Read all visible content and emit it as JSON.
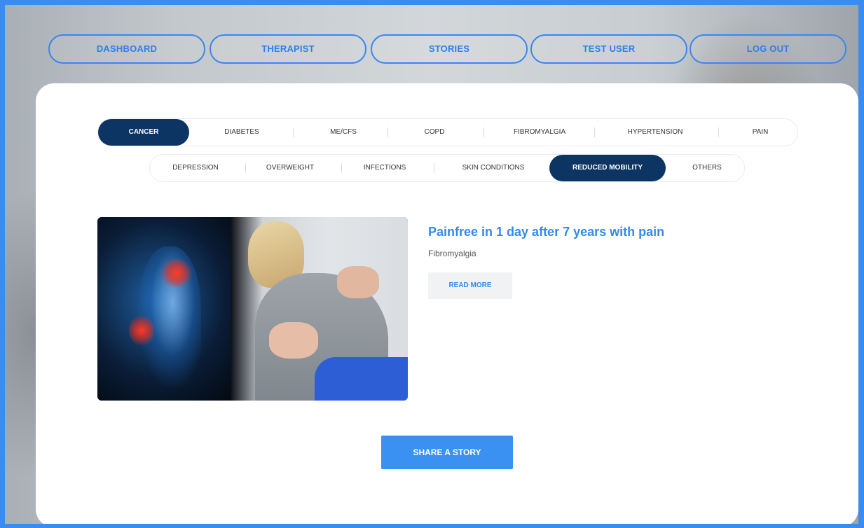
{
  "nav": {
    "items": [
      {
        "label": "DASHBOARD"
      },
      {
        "label": "THERAPIST"
      },
      {
        "label": "STORIES"
      },
      {
        "label": "TEST USER"
      },
      {
        "label": "LOG OUT"
      }
    ]
  },
  "categories": {
    "row1": [
      {
        "label": "CANCER",
        "active": true
      },
      {
        "label": "DIABETES"
      },
      {
        "label": "ME/CFS"
      },
      {
        "label": "COPD"
      },
      {
        "label": "FIBROMYALGIA"
      },
      {
        "label": "HYPERTENSION"
      },
      {
        "label": "PAIN"
      }
    ],
    "row2": [
      {
        "label": "DEPRESSION"
      },
      {
        "label": "OVERWEIGHT"
      },
      {
        "label": "INFECTIONS"
      },
      {
        "label": "SKIN CONDITIONS"
      },
      {
        "label": "REDUCED MOBILITY",
        "active": true
      },
      {
        "label": "OTHERS"
      }
    ]
  },
  "story": {
    "title": "Painfree in 1 day after 7 years with pain",
    "category": "Fibromyalgia",
    "read_more": "READ MORE"
  },
  "share_button": "SHARE A STORY",
  "colors": {
    "accent": "#3a86ee",
    "active_tab": "#0c3563",
    "share": "#3a91f2"
  }
}
